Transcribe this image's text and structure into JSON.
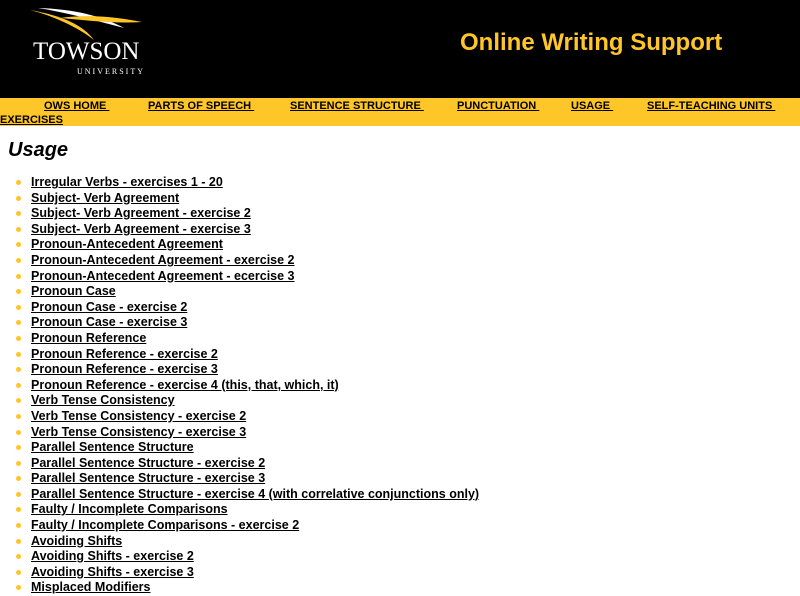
{
  "header": {
    "logo_name": "TOWSON",
    "logo_sub": "UNIVERSITY",
    "site_title": "Online Writing Support"
  },
  "nav": {
    "items": [
      {
        "label": "OWS HOME "
      },
      {
        "label": "PARTS OF SPEECH "
      },
      {
        "label": "SENTENCE STRUCTURE "
      },
      {
        "label": "PUNCTUATION "
      },
      {
        "label": "USAGE "
      },
      {
        "label": "SELF-TEACHING UNITS "
      },
      {
        "label": "EXERCISES"
      }
    ]
  },
  "page_title": "Usage",
  "links": [
    "Irregular Verbs - exercises 1 - 20",
    "Subject- Verb Agreement",
    "Subject- Verb Agreement - exercise 2",
    "Subject- Verb Agreement - exercise 3",
    "Pronoun-Antecedent Agreement",
    "Pronoun-Antecedent Agreement - exercise 2",
    "Pronoun-Antecedent Agreement - ecercise 3",
    "Pronoun Case",
    "Pronoun Case - exercise 2",
    "Pronoun Case - exercise 3",
    "Pronoun Reference",
    "Pronoun Reference - exercise 2",
    "Pronoun Reference - exercise 3",
    "Pronoun Reference - exercise 4 (this, that, which, it)",
    "Verb Tense Consistency",
    "Verb Tense Consistency - exercise 2",
    "Verb Tense Consistency - exercise 3",
    "Parallel Sentence Structure",
    "Parallel Sentence Structure - exercise 2",
    "Parallel Sentence Structure - exercise 3",
    "Parallel Sentence Structure - exercise 4 (with correlative conjunctions only)",
    "Faulty / Incomplete Comparisons",
    "Faulty / Incomplete Comparisons - exercise 2",
    "Avoiding Shifts",
    "Avoiding Shifts - exercise 2",
    "Avoiding Shifts - exercise 3",
    "Misplaced Modifiers"
  ],
  "colors": {
    "brand_gold": "#ffc629",
    "header_bg": "#000000"
  },
  "icons": {
    "logo_mark": "tiger-stripe-swoosh-icon",
    "bullet": "gold-dot-icon"
  }
}
